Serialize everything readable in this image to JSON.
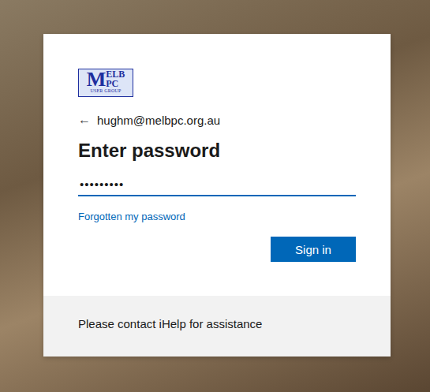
{
  "logo": {
    "initial": "M",
    "top": "ELB",
    "bottom": "PC",
    "tagline": "USER GROUP"
  },
  "account": {
    "back": "←",
    "email": "hughm@melbpc.org.au"
  },
  "title": "Enter password",
  "password": {
    "value": "•••••••••",
    "focused": true
  },
  "forgot_link": "Forgotten my password",
  "buttons": [
    "Sign in"
  ],
  "footer": "Please contact iHelp for assistance"
}
